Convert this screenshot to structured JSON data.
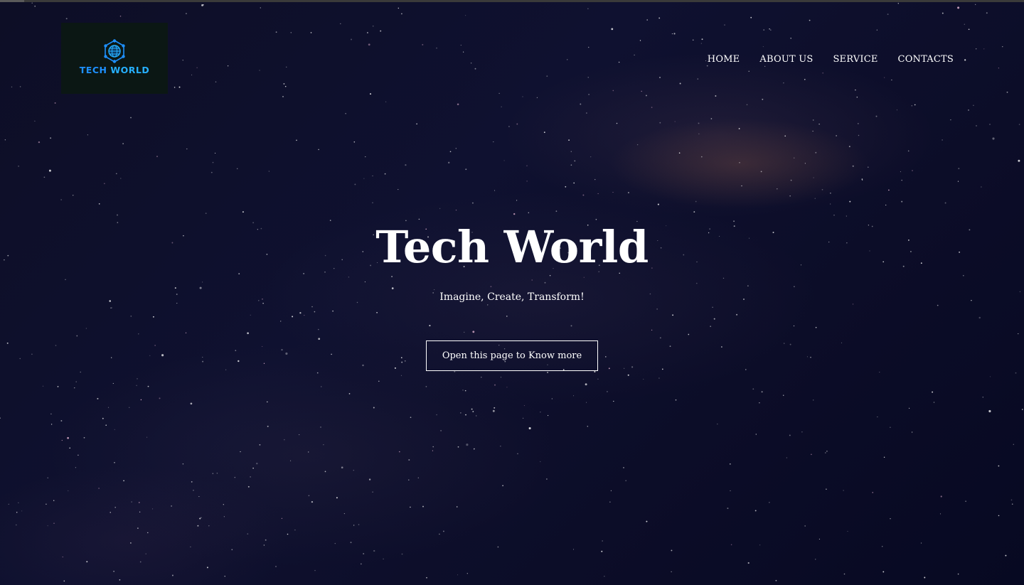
{
  "logo": {
    "text_part1": "TECH ",
    "text_part2": "WORLD",
    "icon": "globe-network-icon"
  },
  "nav": {
    "items": [
      {
        "label": "HOME"
      },
      {
        "label": "ABOUT US"
      },
      {
        "label": "SERVICE"
      },
      {
        "label": "CONTACTS"
      }
    ]
  },
  "hero": {
    "title": "Tech World",
    "subtitle": "Imagine, Create, Transform!",
    "button_label": "Open this page to Know more"
  },
  "colors": {
    "background": "#0d0e26",
    "text": "#ffffff",
    "logo_accent": "#1e90ff",
    "logo_background": "#0b1714"
  }
}
